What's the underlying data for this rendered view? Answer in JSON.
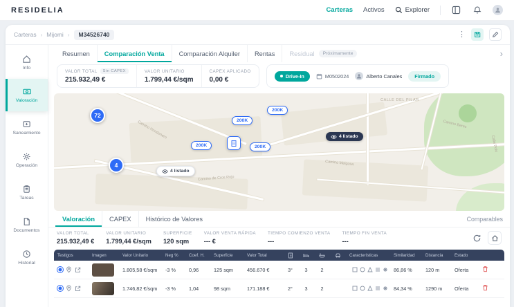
{
  "topnav": {
    "logo": "RESIDELIA",
    "links": [
      {
        "label": "Carteras"
      },
      {
        "label": "Activos"
      }
    ],
    "explorer": "Explorer"
  },
  "breadcrumb": {
    "root": "Carteras",
    "portfolio": "Mijomi",
    "asset_id": "M34526740"
  },
  "sidebar": {
    "items": [
      {
        "label": "Info"
      },
      {
        "label": "Valoración"
      },
      {
        "label": "Saneamiento"
      },
      {
        "label": "Operación"
      },
      {
        "label": "Tareas"
      },
      {
        "label": "Documentos"
      },
      {
        "label": "Historial"
      }
    ]
  },
  "tabs": {
    "items": [
      {
        "label": "Resumen"
      },
      {
        "label": "Comparación Venta"
      },
      {
        "label": "Comparación Alquiler"
      },
      {
        "label": "Rentas"
      },
      {
        "label": "Residual"
      }
    ],
    "coming_soon": "Próximamente"
  },
  "stats": {
    "cards": [
      {
        "label": "VALOR TOTAL",
        "value": "215.932,49 €",
        "badge": "Sin CAPEX"
      },
      {
        "label": "VALOR UNITARIO",
        "value": "1.799,44 €/sqm"
      },
      {
        "label": "CAPEX APLICADO",
        "value": "0,00 €"
      }
    ]
  },
  "meta": {
    "type_chip": "Drive-In",
    "ref": "M0502024",
    "owner": "Alberto Canales",
    "signed": "Firmado"
  },
  "map": {
    "clusters": [
      {
        "label": "72"
      },
      {
        "label": "4"
      }
    ],
    "price_pills": [
      {
        "label": "200K"
      },
      {
        "label": "200K"
      },
      {
        "label": "200K"
      },
      {
        "label": "200K"
      }
    ],
    "listing_pills": [
      {
        "label": "4 listado"
      },
      {
        "label": "4 listado"
      }
    ],
    "street_labels": [
      {
        "label": "CALLE DEL PILAR"
      },
      {
        "label": "Camino Beres"
      },
      {
        "label": "Calle Polo"
      },
      {
        "label": "Camino Melgosa"
      },
      {
        "label": "Camino de Cros Rojo"
      },
      {
        "label": "Camino Hondonero"
      }
    ]
  },
  "bottom_tabs": {
    "items": [
      {
        "label": "Valoración"
      },
      {
        "label": "CAPEX"
      },
      {
        "label": "Histórico de Valores"
      }
    ],
    "right_label": "Comparables"
  },
  "summary": {
    "stats": [
      {
        "label": "VALOR TOTAL",
        "value": "215.932,49 €"
      },
      {
        "label": "VALOR UNITARIO",
        "value": "1.799,44 €/sqm"
      },
      {
        "label": "SUPERFICIE",
        "value": "120 sqm"
      },
      {
        "label": "VALOR VENTA RÁPIDA",
        "value": "--- €"
      },
      {
        "label": "TIEMPO COMIENZO VENTA",
        "value": "---"
      },
      {
        "label": "TIEMPO FIN VENTA",
        "value": "---"
      }
    ]
  },
  "table": {
    "headers": {
      "testigos": "Testigos",
      "imagen": "Imagen",
      "valor_unitario": "Valor Unitario",
      "neg": "Neg %",
      "coef": "Coef. H.",
      "superficie": "Superficie",
      "valor_total": "Valor Total",
      "caracteristicas": "Características",
      "similaridad": "Similaridad",
      "distancia": "Distancia",
      "estado": "Estado"
    },
    "rows": [
      {
        "valor_unitario": "1.805,58 €/sqm",
        "neg": "-3 %",
        "coef": "0,96",
        "superficie": "125 sqm",
        "valor_total": "456.670 €",
        "planta": "3°",
        "habitaciones": "3",
        "banos": "2",
        "similaridad": "86,86 %",
        "distancia": "120 m",
        "estado": "Oferta"
      },
      {
        "valor_unitario": "1.746,82 €/sqm",
        "neg": "-3 %",
        "coef": "1,04",
        "superficie": "98 sqm",
        "valor_total": "171.188 €",
        "planta": "2°",
        "habitaciones": "3",
        "banos": "2",
        "similaridad": "84,34 %",
        "distancia": "1290 m",
        "estado": "Oferta"
      }
    ]
  }
}
